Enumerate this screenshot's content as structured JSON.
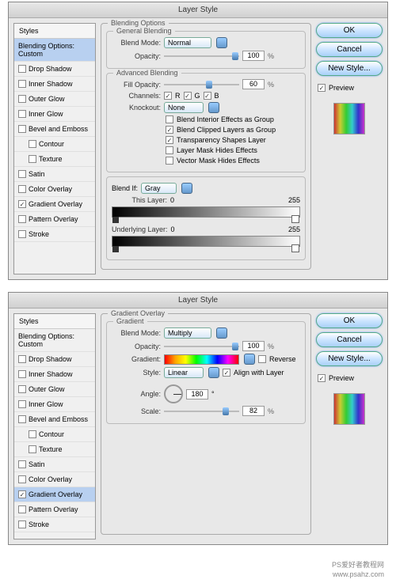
{
  "title": "Layer Style",
  "styles_header": "Styles",
  "styles": [
    {
      "label": "Blending Options: Custom",
      "sel": true,
      "checked": null
    },
    {
      "label": "Drop Shadow",
      "checked": false
    },
    {
      "label": "Inner Shadow",
      "checked": false
    },
    {
      "label": "Outer Glow",
      "checked": false
    },
    {
      "label": "Inner Glow",
      "checked": false
    },
    {
      "label": "Bevel and Emboss",
      "checked": false
    },
    {
      "label": "Contour",
      "checked": false,
      "indent": true
    },
    {
      "label": "Texture",
      "checked": false,
      "indent": true
    },
    {
      "label": "Satin",
      "checked": false
    },
    {
      "label": "Color Overlay",
      "checked": false
    },
    {
      "label": "Gradient Overlay",
      "checked": true
    },
    {
      "label": "Pattern Overlay",
      "checked": false
    },
    {
      "label": "Stroke",
      "checked": false
    }
  ],
  "buttons": {
    "ok": "OK",
    "cancel": "Cancel",
    "new_style": "New Style...",
    "preview": "Preview"
  },
  "top": {
    "section": "Blending Options",
    "general": {
      "title": "General Blending",
      "blend_mode_lbl": "Blend Mode:",
      "blend_mode": "Normal",
      "opacity_lbl": "Opacity:",
      "opacity": "100",
      "pct": "%"
    },
    "advanced": {
      "title": "Advanced Blending",
      "fill_opacity_lbl": "Fill Opacity:",
      "fill_opacity": "60",
      "channels_lbl": "Channels:",
      "r": "R",
      "g": "G",
      "b": "B",
      "knockout_lbl": "Knockout:",
      "knockout": "None",
      "opts": [
        "Blend Interior Effects as Group",
        "Blend Clipped Layers as Group",
        "Transparency Shapes Layer",
        "Layer Mask Hides Effects",
        "Vector Mask Hides Effects"
      ],
      "opts_checked": [
        false,
        true,
        true,
        false,
        false
      ]
    },
    "blendif": {
      "lbl": "Blend If:",
      "val": "Gray",
      "this": "This Layer:",
      "under": "Underlying Layer:",
      "min": "0",
      "max": "255"
    }
  },
  "bottom": {
    "section": "Gradient Overlay",
    "grad": {
      "title": "Gradient",
      "blend_mode_lbl": "Blend Mode:",
      "blend_mode": "Multiply",
      "opacity_lbl": "Opacity:",
      "opacity": "100",
      "pct": "%",
      "gradient_lbl": "Gradient:",
      "reverse": "Reverse",
      "style_lbl": "Style:",
      "style": "Linear",
      "align": "Align with Layer",
      "angle_lbl": "Angle:",
      "angle": "180",
      "deg": "°",
      "scale_lbl": "Scale:",
      "scale": "82"
    },
    "styles_sel": "Gradient Overlay"
  },
  "watermark": {
    "l1": "PS爱好者教程网",
    "l2": "www.psahz.com"
  }
}
